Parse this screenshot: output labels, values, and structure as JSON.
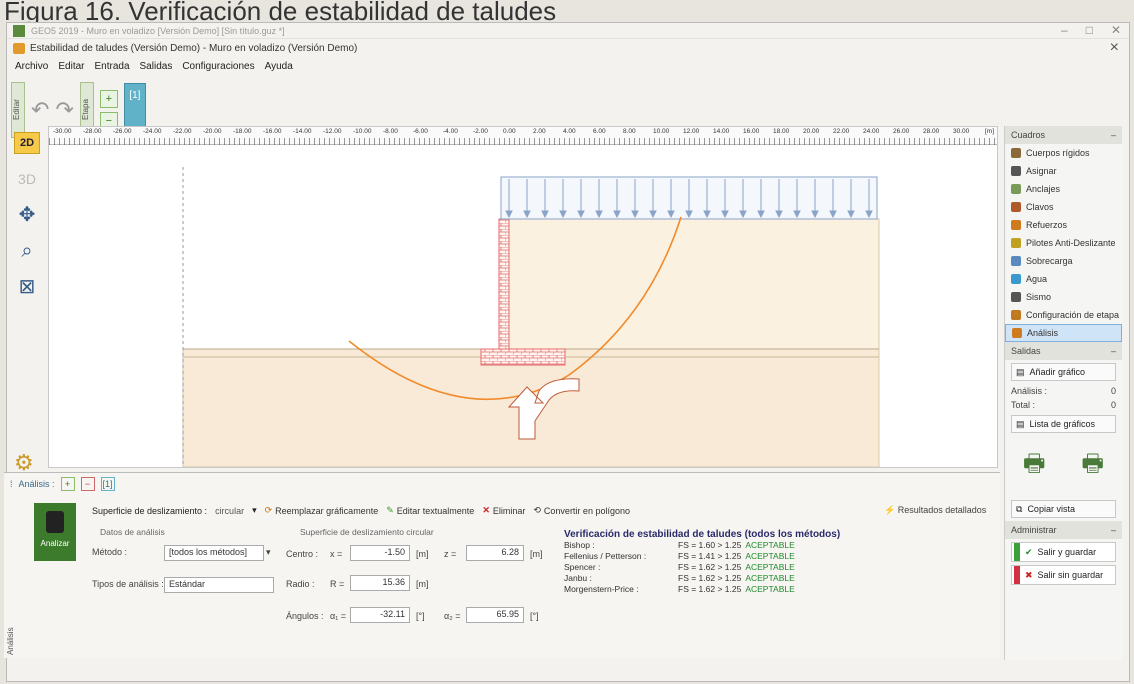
{
  "caption": "Figura 16. Verificación de estabilidad de taludes",
  "outer_window": {
    "title": "GEO5 2019 - Muro en voladizo [Versión Demo] [Sin título.guz *]"
  },
  "inner_window": {
    "title": "Estabilidad de taludes (Versión Demo) - Muro en voladizo (Versión Demo)"
  },
  "menu": [
    "Archivo",
    "Editar",
    "Entrada",
    "Salidas",
    "Configuraciones",
    "Ayuda"
  ],
  "toolbar": {
    "editar_tab": "Editar",
    "etapa_tab": "Etapa",
    "stage_label": "[1]"
  },
  "view": {
    "btn_2d": "2D"
  },
  "ruler_ticks": [
    "-30.00",
    "-28.00",
    "-26.00",
    "-24.00",
    "-22.00",
    "-20.00",
    "-18.00",
    "-16.00",
    "-14.00",
    "-12.00",
    "-10.00",
    "-8.00",
    "-6.00",
    "-4.00",
    "-2.00",
    "0.00",
    "2.00",
    "4.00",
    "6.00",
    "8.00",
    "10.00",
    "12.00",
    "14.00",
    "16.00",
    "18.00",
    "20.00",
    "22.00",
    "24.00",
    "26.00",
    "28.00",
    "30.00",
    "[m]"
  ],
  "right_panel": {
    "cuadros_title": "Cuadros",
    "items": [
      {
        "label": "Cuerpos rígidos",
        "color": "#8a6a3a"
      },
      {
        "label": "Asignar",
        "color": "#555555"
      },
      {
        "label": "Anclajes",
        "color": "#7a9a5a"
      },
      {
        "label": "Clavos",
        "color": "#b05a2a"
      },
      {
        "label": "Refuerzos",
        "color": "#d07a20"
      },
      {
        "label": "Pilotes Anti-Deslizante",
        "color": "#c0a020"
      },
      {
        "label": "Sobrecarga",
        "color": "#5a8ac0"
      },
      {
        "label": "Agua",
        "color": "#3a9ad0"
      },
      {
        "label": "Sismo",
        "color": "#555555"
      },
      {
        "label": "Configuración de etapa",
        "color": "#c07a20"
      },
      {
        "label": "Análisis",
        "color": "#d07a20"
      }
    ],
    "salidas_title": "Salidas",
    "add_graph": "Añadir gráfico",
    "analisis_label": "Análisis :",
    "analisis_count": "0",
    "total_label": "Total :",
    "total_count": "0",
    "graph_list": "Lista de gráficos",
    "copy_view": "Copiar vista",
    "administrar_title": "Administrar",
    "save_exit": "Salir y guardar",
    "exit_nosave": "Salir sin guardar"
  },
  "bottom": {
    "analisis_label": "Análisis :",
    "stage_label": "[1]",
    "analizar": "Analizar",
    "analisis_vtab": "Análisis",
    "slip_surface_label": "Superficie de deslizamiento :",
    "slip_surface_value": "circular",
    "replace_graphic": "Reemplazar gráficamente",
    "edit_text": "Editar textualmente",
    "delete": "Eliminar",
    "convert_polygon": "Convertir en polígono",
    "detailed_results": "Resultados detallados",
    "datos_title": "Datos de análisis",
    "metodo_label": "Método :",
    "metodo_value": "[todos los métodos]",
    "tipos_label": "Tipos de análisis :",
    "tipos_value": "Estándar",
    "circ_title": "Superficie de deslizamiento circular",
    "centro_label": "Centro :",
    "x_label": "x =",
    "x_value": "-1.50",
    "z_label": "z =",
    "z_value": "6.28",
    "radio_label": "Radio :",
    "r_label": "R =",
    "r_value": "15.36",
    "angulos_label": "Ángulos :",
    "a1_label": "α₁ =",
    "a1_value": "-32.11",
    "a2_label": "α₂ =",
    "a2_value": "65.95",
    "unit_m": "[m]",
    "unit_deg": "[°]"
  },
  "verification": {
    "title": "Verificación de estabilidad de taludes (todos los métodos)",
    "rows": [
      {
        "method": "Bishop :",
        "value": "FS = 1.60 > 1.25",
        "status": "ACEPTABLE"
      },
      {
        "method": "Fellenius / Petterson :",
        "value": "FS = 1.41 > 1.25",
        "status": "ACEPTABLE"
      },
      {
        "method": "Spencer :",
        "value": "FS = 1.62 > 1.25",
        "status": "ACEPTABLE"
      },
      {
        "method": "Janbu :",
        "value": "FS = 1.62 > 1.25",
        "status": "ACEPTABLE"
      },
      {
        "method": "Morgenstern-Price :",
        "value": "FS = 1.62 > 1.25",
        "status": "ACEPTABLE"
      }
    ]
  },
  "colors": {
    "soil_fill": "#fbf1e0",
    "slip_circle": "#f28a2a",
    "surcharge": "#8aa3c8",
    "wall": "#e46a6a"
  }
}
